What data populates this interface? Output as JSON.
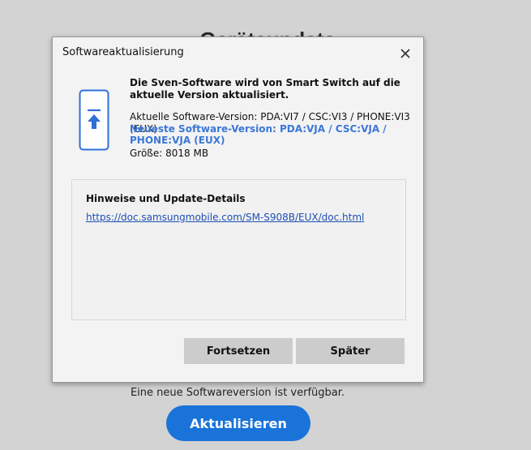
{
  "background": {
    "title": "Geräteupdate",
    "notice": "Eine neue Softwareversion ist verfügbar.",
    "update_button": "Aktualisieren"
  },
  "dialog": {
    "title": "Softwareaktualisierung",
    "close_icon": "close-icon",
    "phone_icon": "phone-update-icon",
    "message": "Die Sven-Software wird von Smart Switch auf die aktuelle Version aktualisiert.",
    "current_version": "Aktuelle Software-Version: PDA:VI7 / CSC:VI3 / PHONE:VI3 (EUX)",
    "new_version": "Neueste Software-Version: PDA:VJA / CSC:VJA / PHONE:VJA (EUX)",
    "size": "Größe: 8018 MB",
    "notes": {
      "heading": "Hinweise und Update-Details",
      "link": "https://doc.samsungmobile.com/SM-S908B/EUX/doc.html"
    },
    "buttons": {
      "continue": "Fortsetzen",
      "later": "Später"
    }
  },
  "colors": {
    "accent": "#1a73d9",
    "new_version_text": "#3b77d8",
    "link": "#1e4fb5",
    "button_gray": "#cccccc"
  }
}
